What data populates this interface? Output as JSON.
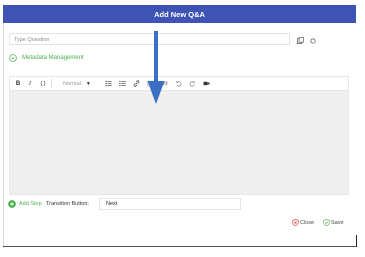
{
  "dialog": {
    "title": "Add New Q&A"
  },
  "question": {
    "placeholder": "Type Question"
  },
  "metadata": {
    "label": "Metadata Management"
  },
  "toolbar": {
    "bold": "B",
    "italic": "I",
    "code": "{ }",
    "format_selected": "Normal",
    "icons": [
      "bulleted-list-icon",
      "numbered-list-icon",
      "link-icon",
      "image-icon",
      "quote-icon",
      "undo-icon",
      "redo-icon",
      "video-icon"
    ]
  },
  "step": {
    "add_label": "Add Step",
    "transition_label": "Transition Button:",
    "transition_value": "Next"
  },
  "footer": {
    "close_label": "Close",
    "save_label": "Save"
  },
  "colors": {
    "header": "#3f53b5",
    "accent_green": "#4caf50",
    "close_red": "#e53935",
    "arrow_blue": "#3a6fc4",
    "editor_bg": "#efefef"
  }
}
